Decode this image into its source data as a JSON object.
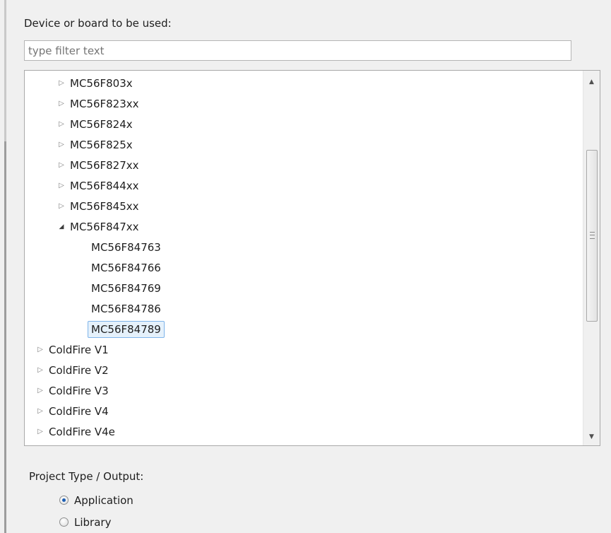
{
  "device_section": {
    "label": "Device or board to be used:",
    "filter_placeholder": "type filter text",
    "filter_value": ""
  },
  "tree": {
    "items": [
      {
        "label": "MC56F803x",
        "state": "collapsed"
      },
      {
        "label": "MC56F823xx",
        "state": "collapsed"
      },
      {
        "label": "MC56F824x",
        "state": "collapsed"
      },
      {
        "label": "MC56F825x",
        "state": "collapsed"
      },
      {
        "label": "MC56F827xx",
        "state": "collapsed"
      },
      {
        "label": "MC56F844xx",
        "state": "collapsed"
      },
      {
        "label": "MC56F845xx",
        "state": "collapsed"
      },
      {
        "label": "MC56F847xx",
        "state": "expanded"
      },
      {
        "label": "MC56F84763",
        "state": "leaf"
      },
      {
        "label": "MC56F84766",
        "state": "leaf"
      },
      {
        "label": "MC56F84769",
        "state": "leaf"
      },
      {
        "label": "MC56F84786",
        "state": "leaf"
      },
      {
        "label": "MC56F84789",
        "state": "leaf",
        "selected": true
      },
      {
        "label": "ColdFire V1",
        "state": "collapsed"
      },
      {
        "label": "ColdFire V2",
        "state": "collapsed"
      },
      {
        "label": "ColdFire V3",
        "state": "collapsed"
      },
      {
        "label": "ColdFire V4",
        "state": "collapsed"
      },
      {
        "label": "ColdFire V4e",
        "state": "collapsed"
      }
    ],
    "icons": {
      "collapsed": "triangle-right-icon",
      "expanded": "triangle-down-icon"
    },
    "selection_color": "#e5f1fb",
    "selection_border": "#7eb4ea"
  },
  "scrollbar": {
    "up_icon": "scroll-up-arrow-icon",
    "down_icon": "scroll-down-arrow-icon",
    "grip_icon": "grip-icon"
  },
  "project_section": {
    "label": "Project Type / Output:",
    "options": [
      {
        "label": "Application",
        "checked": true
      },
      {
        "label": "Library",
        "checked": false
      }
    ]
  }
}
